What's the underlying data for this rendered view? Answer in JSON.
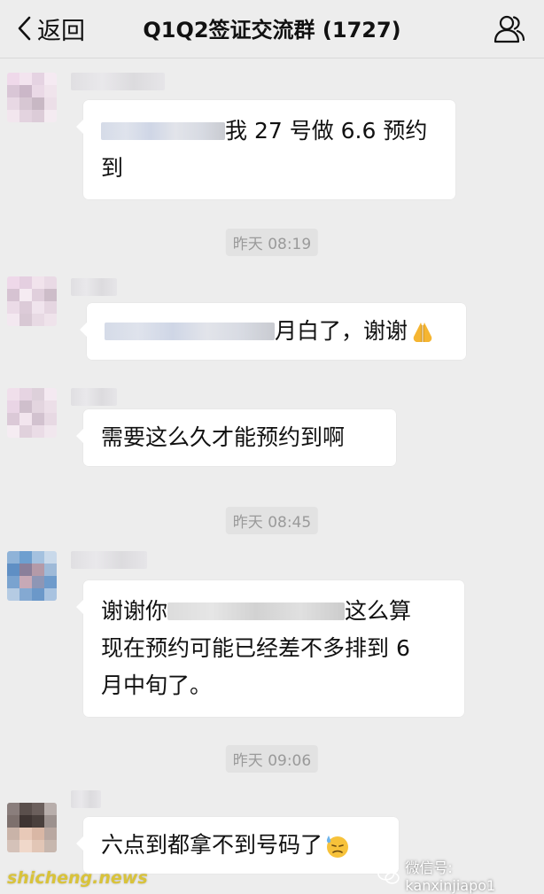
{
  "header": {
    "back_label": "返回",
    "title": "Q1Q2签证交流群 (1727)",
    "group_icon": "group-members-icon"
  },
  "messages": [
    {
      "text_visible": "我27号做6.6预约到",
      "line1": "我 27 号做 6.6 预约",
      "line2": "到"
    },
    {
      "text_visible": "明白了，谢谢",
      "line1": "月白了，谢谢",
      "emoji": "folded-hands"
    },
    {
      "text_visible": "需要这么久才能预约到啊",
      "line1": "需要这么久才能预约到啊"
    },
    {
      "line1_start": "谢谢你",
      "line1_end": "这么算",
      "line2": "现在预约可能已经差不多排到 6",
      "line3": "月中旬了。"
    },
    {
      "line1": "六点到都拿不到号码了",
      "emoji": "downcast-face-with-sweat"
    }
  ],
  "timestamps": [
    "昨天 08:19",
    "昨天 08:45",
    "昨天 09:06"
  ],
  "watermarks": {
    "site": "shicheng.news",
    "wechat": "微信号: kanxinjiapo1"
  }
}
